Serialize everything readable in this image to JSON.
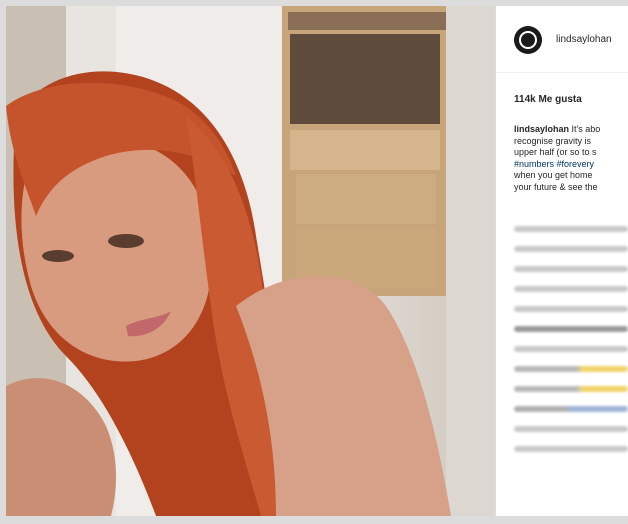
{
  "post": {
    "username": "lindsaylohan",
    "likes": "114k Me gusta",
    "caption": {
      "user": "lindsaylohan",
      "line1_text": "It's abo",
      "line2": "recognise gravity is",
      "line3": "upper half (or so to s",
      "line4_tags": "#numbers #forevery",
      "line5": "when you get home",
      "line6": "your future & see the"
    }
  },
  "icons": {
    "avatar": "profile-avatar-icon"
  },
  "colors": {
    "hair": "#c2502a",
    "skin": "#d9a085",
    "wall": "#e3dfda",
    "cabinet": "#b9946a",
    "link": "#003569"
  }
}
